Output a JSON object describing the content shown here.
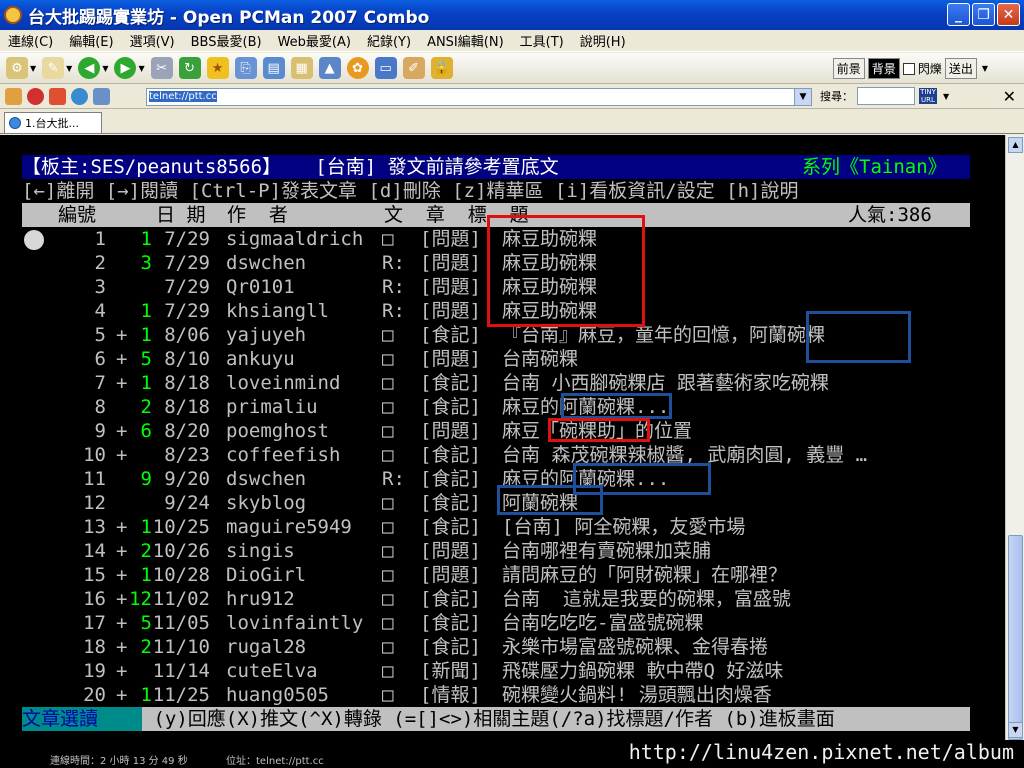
{
  "window": {
    "title": "台大批踢踢實業坊 - Open PCMan 2007 Combo"
  },
  "menu": [
    "連線(C)",
    "編輯(E)",
    "選項(V)",
    "BBS最愛(B)",
    "Web最愛(A)",
    "紀錄(Y)",
    "ANSI編輯(N)",
    "工具(T)",
    "說明(H)"
  ],
  "toolbar": {
    "front_label": "前景",
    "back_label": "背景",
    "blink_label": "閃爍",
    "send_label": "送出"
  },
  "address": {
    "url": "telnet://ptt.cc",
    "search_label": "搜尋："
  },
  "tab": {
    "label": "1.台大批..."
  },
  "terminal": {
    "board_header": "【板主:SES/peanuts8566】   [台南] 發文前請參考置底文",
    "series": "系列《Tainan》",
    "help_line": "[←]離開 [→]閱讀 [Ctrl-P]發表文章 [d]刪除 [z]精華區 [i]看板資訊/設定 [h]說明",
    "columns": {
      "num": "編號",
      "date": "日 期",
      "author": "作  者",
      "title": "文  章  標  題"
    },
    "popularity": "人氣:386",
    "posts": [
      {
        "num": "1",
        "mark": "",
        "recommend": "1",
        "date": "7/29",
        "author": "sigmaaldrich",
        "reply": "□",
        "category": "[問題]",
        "title": "麻豆助碗粿"
      },
      {
        "num": "2",
        "mark": "",
        "recommend": "3",
        "date": "7/29",
        "author": "dswchen",
        "reply": "R:",
        "category": "[問題]",
        "title": "麻豆助碗粿"
      },
      {
        "num": "3",
        "mark": "",
        "recommend": "",
        "date": "7/29",
        "author": "Qr0101",
        "reply": "R:",
        "category": "[問題]",
        "title": "麻豆助碗粿"
      },
      {
        "num": "4",
        "mark": "",
        "recommend": "1",
        "date": "7/29",
        "author": "khsiangll",
        "reply": "R:",
        "category": "[問題]",
        "title": "麻豆助碗粿"
      },
      {
        "num": "5",
        "mark": "+",
        "recommend": "1",
        "date": "8/06",
        "author": "yajuyeh",
        "reply": "□",
        "category": "[食記]",
        "title": "『台南』麻豆，童年的回憶，阿蘭碗粿"
      },
      {
        "num": "6",
        "mark": "+",
        "recommend": "5",
        "date": "8/10",
        "author": "ankuyu",
        "reply": "□",
        "category": "[問題]",
        "title": "台南碗粿"
      },
      {
        "num": "7",
        "mark": "+",
        "recommend": "1",
        "date": "8/18",
        "author": "loveinmind",
        "reply": "□",
        "category": "[食記]",
        "title": "台南 小西腳碗粿店 跟著藝術家吃碗粿"
      },
      {
        "num": "8",
        "mark": "",
        "recommend": "2",
        "date": "8/18",
        "author": "primaliu",
        "reply": "□",
        "category": "[食記]",
        "title": "麻豆的阿蘭碗粿..."
      },
      {
        "num": "9",
        "mark": "+",
        "recommend": "6",
        "date": "8/20",
        "author": "poemghost",
        "reply": "□",
        "category": "[問題]",
        "title": "麻豆「碗粿助」的位置"
      },
      {
        "num": "10",
        "mark": "+",
        "recommend": "",
        "date": "8/23",
        "author": "coffeefish",
        "reply": "□",
        "category": "[食記]",
        "title": "台南 森茂碗粿辣椒醬, 武廟肉圓, 義豐 …"
      },
      {
        "num": "11",
        "mark": "",
        "recommend": "9",
        "date": "9/20",
        "author": "dswchen",
        "reply": "R:",
        "category": "[食記]",
        "title": "麻豆的阿蘭碗粿..."
      },
      {
        "num": "12",
        "mark": "",
        "recommend": "",
        "date": "9/24",
        "author": "skyblog",
        "reply": "□",
        "category": "[食記]",
        "title": "阿蘭碗粿"
      },
      {
        "num": "13",
        "mark": "+",
        "recommend": "1",
        "date": "10/25",
        "author": "maguire5949",
        "reply": "□",
        "category": "[食記]",
        "title": "[台南] 阿全碗粿，友愛市場"
      },
      {
        "num": "14",
        "mark": "+",
        "recommend": "2",
        "date": "10/26",
        "author": "singis",
        "reply": "□",
        "category": "[問題]",
        "title": "台南哪裡有賣碗粿加菜脯"
      },
      {
        "num": "15",
        "mark": "+",
        "recommend": "1",
        "date": "10/28",
        "author": "DioGirl",
        "reply": "□",
        "category": "[問題]",
        "title": "請問麻豆的「阿財碗粿」在哪裡？"
      },
      {
        "num": "16",
        "mark": "+",
        "recommend": "12",
        "date": "11/02",
        "author": "hru912",
        "reply": "□",
        "category": "[食記]",
        "title": "台南  這就是我要的碗粿，富盛號"
      },
      {
        "num": "17",
        "mark": "+",
        "recommend": "5",
        "date": "11/05",
        "author": "lovinfaintly",
        "reply": "□",
        "category": "[食記]",
        "title": "台南吃吃吃-富盛號碗粿"
      },
      {
        "num": "18",
        "mark": "+",
        "recommend": "2",
        "date": "11/10",
        "author": "rugal28",
        "reply": "□",
        "category": "[食記]",
        "title": "永樂市場富盛號碗粿、金得春捲"
      },
      {
        "num": "19",
        "mark": "+",
        "recommend": "",
        "date": "11/14",
        "author": "cuteElva",
        "reply": "□",
        "category": "[新聞]",
        "title": "飛碟壓力鍋碗粿 軟中帶Q 好滋味"
      },
      {
        "num": "20",
        "mark": "+",
        "recommend": "1",
        "date": "11/25",
        "author": "huang0505",
        "reply": "□",
        "category": "[情報]",
        "title": "碗粿變火鍋料! 湯頭飄出肉燥香"
      }
    ],
    "footer_mode": "文章選讀",
    "footer_help": " (y)回應(X)推文(^X)轉錄 (=[]<>)相關主題(/?a)找標題/作者 (b)進板畫面"
  },
  "status": {
    "connect_time": "連線時間：2 小時 13 分 49 秒",
    "address": "位址：telnet://ptt.cc"
  },
  "watermark": "http://linu4zen.pixnet.net/album",
  "colors": {
    "title_bar": "#0842c8",
    "header_bg": "#000080",
    "highlight_red": "#e01010",
    "highlight_blue": "#1d4f9a",
    "recommend_green": "#00ff00"
  }
}
